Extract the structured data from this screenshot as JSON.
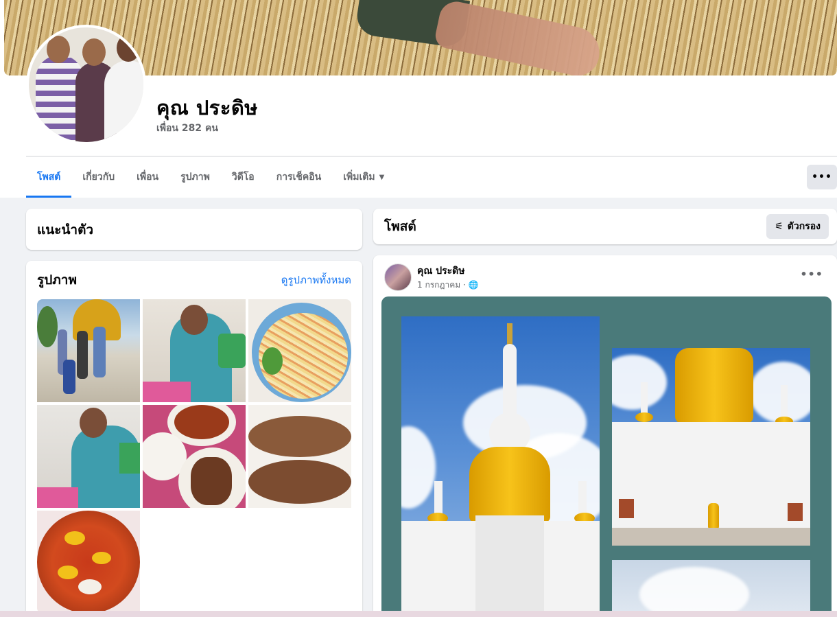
{
  "profile": {
    "name": "คุณ ประดิษ",
    "friends": "เพื่อน 282 คน"
  },
  "tabs": [
    {
      "label": "โพสต์",
      "active": true
    },
    {
      "label": "เกี่ยวกับ"
    },
    {
      "label": "เพื่อน"
    },
    {
      "label": "รูปภาพ"
    },
    {
      "label": "วิดีโอ"
    },
    {
      "label": "การเช็คอิน"
    },
    {
      "label": "เพิ่มเติม",
      "caret": "▼"
    }
  ],
  "more_button": "•••",
  "intro": {
    "title": "แนะนำตัว"
  },
  "photos": {
    "title": "รูปภาพ",
    "see_all": "ดูรูปภาพทั้งหมด"
  },
  "posts": {
    "title": "โพสต์",
    "filter_label": "ตัวกรอง",
    "filter_icon": "⚟"
  },
  "post": {
    "author": "คุณ ประดิษ",
    "date": "1 กรกฎาคม · 🌐",
    "menu": "•••"
  },
  "colors": {
    "accent": "#1877f2",
    "media_bg": "#4a7a7a"
  }
}
